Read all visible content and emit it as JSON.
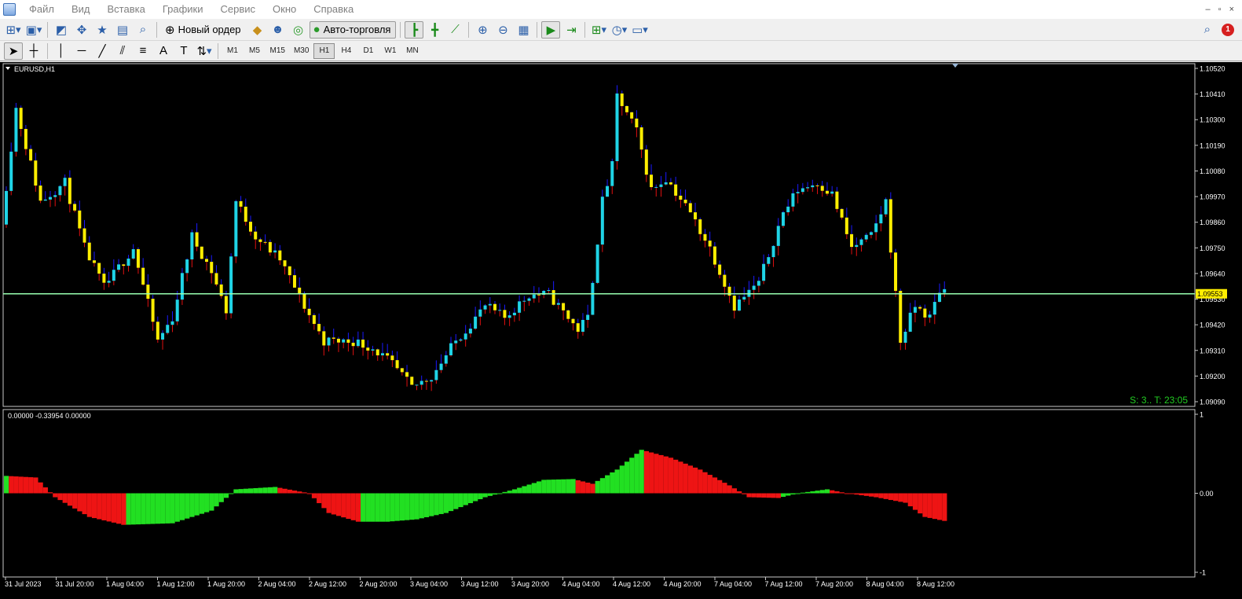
{
  "menu": {
    "items": [
      "Файл",
      "Вид",
      "Вставка",
      "Графики",
      "Сервис",
      "Окно",
      "Справка"
    ]
  },
  "window_controls": [
    "–",
    "▫",
    "×"
  ],
  "toolbar": {
    "new_order_label": "Новый ордер",
    "autotrading_label": "Авто-торговля",
    "alert_count": "1"
  },
  "timeframes": [
    "M1",
    "M5",
    "M15",
    "M30",
    "H1",
    "H4",
    "D1",
    "W1",
    "MN"
  ],
  "active_timeframe": "H1",
  "chart": {
    "symbol_label": "EURUSD,H1",
    "indicator_label": "0.00000 -0.33954 0.00000",
    "current_price": "1.09553",
    "status_text": "S: 3.. T: 23:05",
    "price_ticks": [
      "1.10520",
      "1.10410",
      "1.10300",
      "1.10190",
      "1.10080",
      "1.09970",
      "1.09860",
      "1.09750",
      "1.09640",
      "1.09530",
      "1.09420",
      "1.09310",
      "1.09200",
      "1.09090"
    ],
    "indicator_ticks": [
      "1",
      "0.00",
      "-1"
    ],
    "time_ticks": [
      "31 Jul 2023",
      "31 Jul 20:00",
      "1 Aug 04:00",
      "1 Aug 12:00",
      "1 Aug 20:00",
      "2 Aug 04:00",
      "2 Aug 12:00",
      "2 Aug 20:00",
      "3 Aug 04:00",
      "3 Aug 12:00",
      "3 Aug 20:00",
      "4 Aug 04:00",
      "4 Aug 12:00",
      "4 Aug 20:00",
      "7 Aug 04:00",
      "7 Aug 12:00",
      "7 Aug 20:00",
      "8 Aug 04:00",
      "8 Aug 12:00"
    ]
  },
  "colors": {
    "bull": "#1fd4e6",
    "bear": "#ffee00",
    "wick_up": "#1a1aff",
    "wick_down": "#e01010",
    "hist_up": "#22e022",
    "hist_down": "#ee1414",
    "price_line": "#98ffb0",
    "status": "#22cc22"
  },
  "chart_data": {
    "type": "candlestick",
    "x_unit": "hourly bars (EURUSD H1)",
    "start": "31 Jul 2023",
    "price_range": [
      1.0909,
      1.1052
    ],
    "price_anchors": [
      [
        0,
        1.0985
      ],
      [
        3,
        1.1035
      ],
      [
        8,
        1.0995
      ],
      [
        13,
        1.1003
      ],
      [
        17,
        1.0975
      ],
      [
        21,
        1.0958
      ],
      [
        27,
        1.0975
      ],
      [
        32,
        1.0935
      ],
      [
        35,
        1.0945
      ],
      [
        39,
        1.098
      ],
      [
        43,
        1.0965
      ],
      [
        46,
        1.0948
      ],
      [
        48,
        1.0995
      ],
      [
        52,
        1.098
      ],
      [
        57,
        1.097
      ],
      [
        62,
        1.095
      ],
      [
        66,
        1.0935
      ],
      [
        68,
        1.0935
      ],
      [
        72,
        1.0935
      ],
      [
        76,
        1.0932
      ],
      [
        80,
        1.0925
      ],
      [
        84,
        1.0915
      ],
      [
        88,
        1.092
      ],
      [
        93,
        1.0935
      ],
      [
        99,
        1.095
      ],
      [
        103,
        1.0945
      ],
      [
        108,
        1.0955
      ],
      [
        112,
        1.0955
      ],
      [
        118,
        1.094
      ],
      [
        120,
        1.0945
      ],
      [
        123,
        1.0995
      ],
      [
        125,
        1.101
      ],
      [
        126,
        1.104
      ],
      [
        130,
        1.1025
      ],
      [
        133,
        1.1
      ],
      [
        136,
        1.1005
      ],
      [
        141,
        1.099
      ],
      [
        145,
        1.0975
      ],
      [
        150,
        1.095
      ],
      [
        155,
        1.096
      ],
      [
        160,
        1.099
      ],
      [
        163,
        1.1
      ],
      [
        167,
        1.1003
      ],
      [
        170,
        1.0998
      ],
      [
        174,
        1.0975
      ],
      [
        178,
        1.098
      ],
      [
        181,
        1.0995
      ],
      [
        184,
        1.0935
      ],
      [
        187,
        1.095
      ],
      [
        190,
        1.0945
      ],
      [
        192,
        1.0957
      ]
    ],
    "histogram_anchors": [
      [
        0,
        0.22
      ],
      [
        6,
        0.2
      ],
      [
        10,
        -0.05
      ],
      [
        17,
        -0.3
      ],
      [
        24,
        -0.4
      ],
      [
        34,
        -0.38
      ],
      [
        42,
        -0.22
      ],
      [
        47,
        0.05
      ],
      [
        55,
        0.08
      ],
      [
        62,
        0.0
      ],
      [
        66,
        -0.25
      ],
      [
        72,
        -0.36
      ],
      [
        78,
        -0.36
      ],
      [
        84,
        -0.33
      ],
      [
        90,
        -0.25
      ],
      [
        98,
        -0.05
      ],
      [
        104,
        0.05
      ],
      [
        110,
        0.17
      ],
      [
        116,
        0.18
      ],
      [
        120,
        0.12
      ],
      [
        125,
        0.3
      ],
      [
        130,
        0.55
      ],
      [
        136,
        0.45
      ],
      [
        142,
        0.3
      ],
      [
        148,
        0.1
      ],
      [
        152,
        -0.05
      ],
      [
        158,
        -0.06
      ],
      [
        162,
        0.0
      ],
      [
        168,
        0.05
      ],
      [
        172,
        0.0
      ],
      [
        178,
        -0.05
      ],
      [
        184,
        -0.12
      ],
      [
        188,
        -0.3
      ],
      [
        192,
        -0.35
      ]
    ]
  }
}
